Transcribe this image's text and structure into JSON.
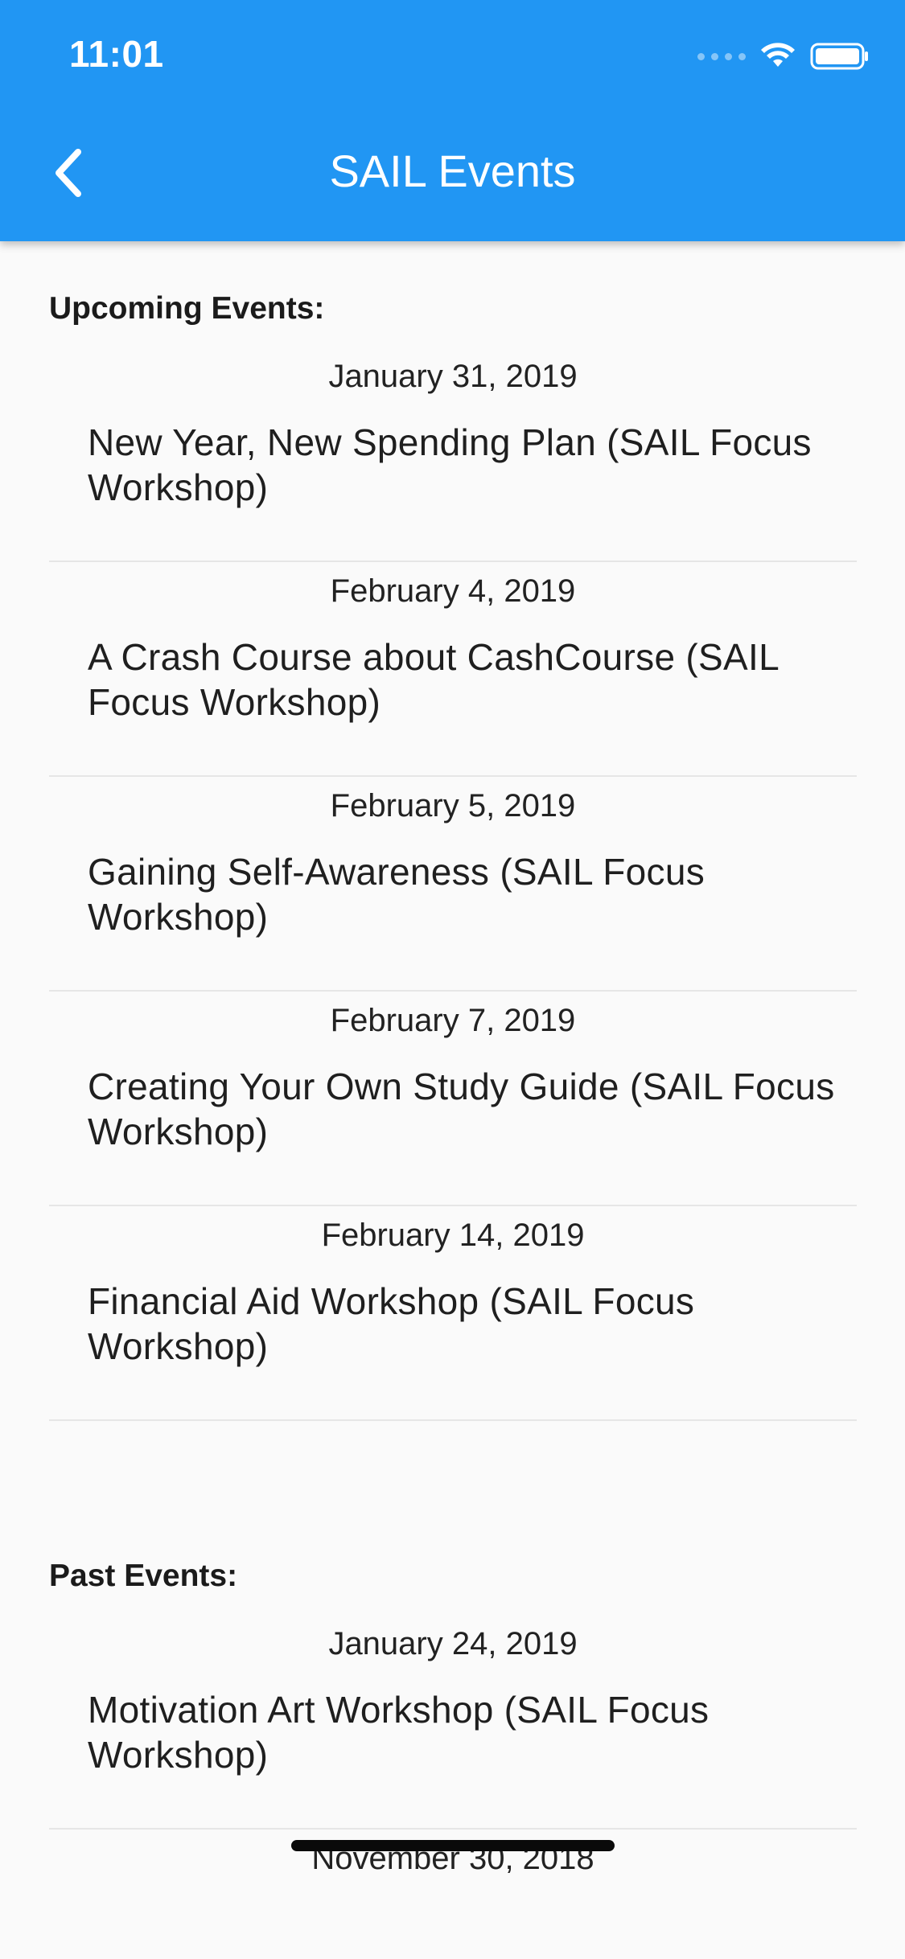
{
  "status_bar": {
    "time": "11:01",
    "icons": [
      "cellular-signal-icon",
      "wifi-icon",
      "battery-icon"
    ]
  },
  "app_bar": {
    "title": "SAIL Events",
    "back_icon": "chevron-left-icon",
    "color": "#2196f3"
  },
  "upcoming": {
    "label": "Upcoming Events:",
    "events": [
      {
        "date": "January 31, 2019",
        "title": "New Year, New Spending Plan (SAIL Focus Workshop)"
      },
      {
        "date": "February 4, 2019",
        "title": "A Crash Course about CashCourse (SAIL Focus Workshop)"
      },
      {
        "date": "February 5, 2019",
        "title": "Gaining Self-Awareness (SAIL Focus Workshop)"
      },
      {
        "date": "February 7, 2019",
        "title": "Creating Your Own Study Guide (SAIL Focus Workshop)"
      },
      {
        "date": "February 14, 2019",
        "title": "Financial Aid Workshop (SAIL Focus Workshop)"
      }
    ]
  },
  "past": {
    "label": "Past Events:",
    "events": [
      {
        "date": "January 24, 2019",
        "title": "Motivation Art Workshop (SAIL Focus Workshop)"
      },
      {
        "date": "November 30, 2018",
        "title": ""
      }
    ]
  }
}
